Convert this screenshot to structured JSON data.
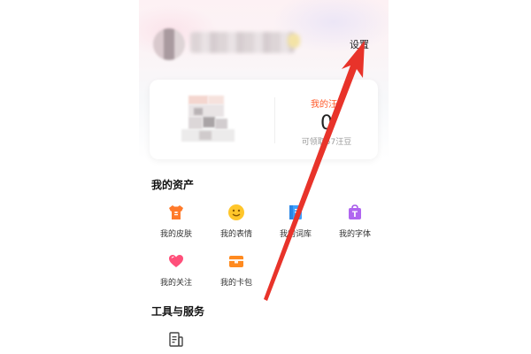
{
  "header": {
    "settings_label": "设置"
  },
  "wangdou_card": {
    "title": "我的汪",
    "count": "0",
    "subtitle": "可领取57汪豆"
  },
  "assets_section": {
    "title": "我的资产",
    "items": [
      {
        "label": "我的皮肤",
        "icon": "tshirt-icon"
      },
      {
        "label": "我的表情",
        "icon": "smiley-icon"
      },
      {
        "label": "我的词库",
        "icon": "book-icon"
      },
      {
        "label": "我的字体",
        "icon": "font-bag-icon"
      },
      {
        "label": "我的关注",
        "icon": "heart-icon"
      },
      {
        "label": "我的卡包",
        "icon": "card-wallet-icon"
      }
    ]
  },
  "tools_section": {
    "title": "工具与服务"
  },
  "colors": {
    "accent_orange": "#ff6a2a",
    "annotation_red": "#e8332a"
  }
}
